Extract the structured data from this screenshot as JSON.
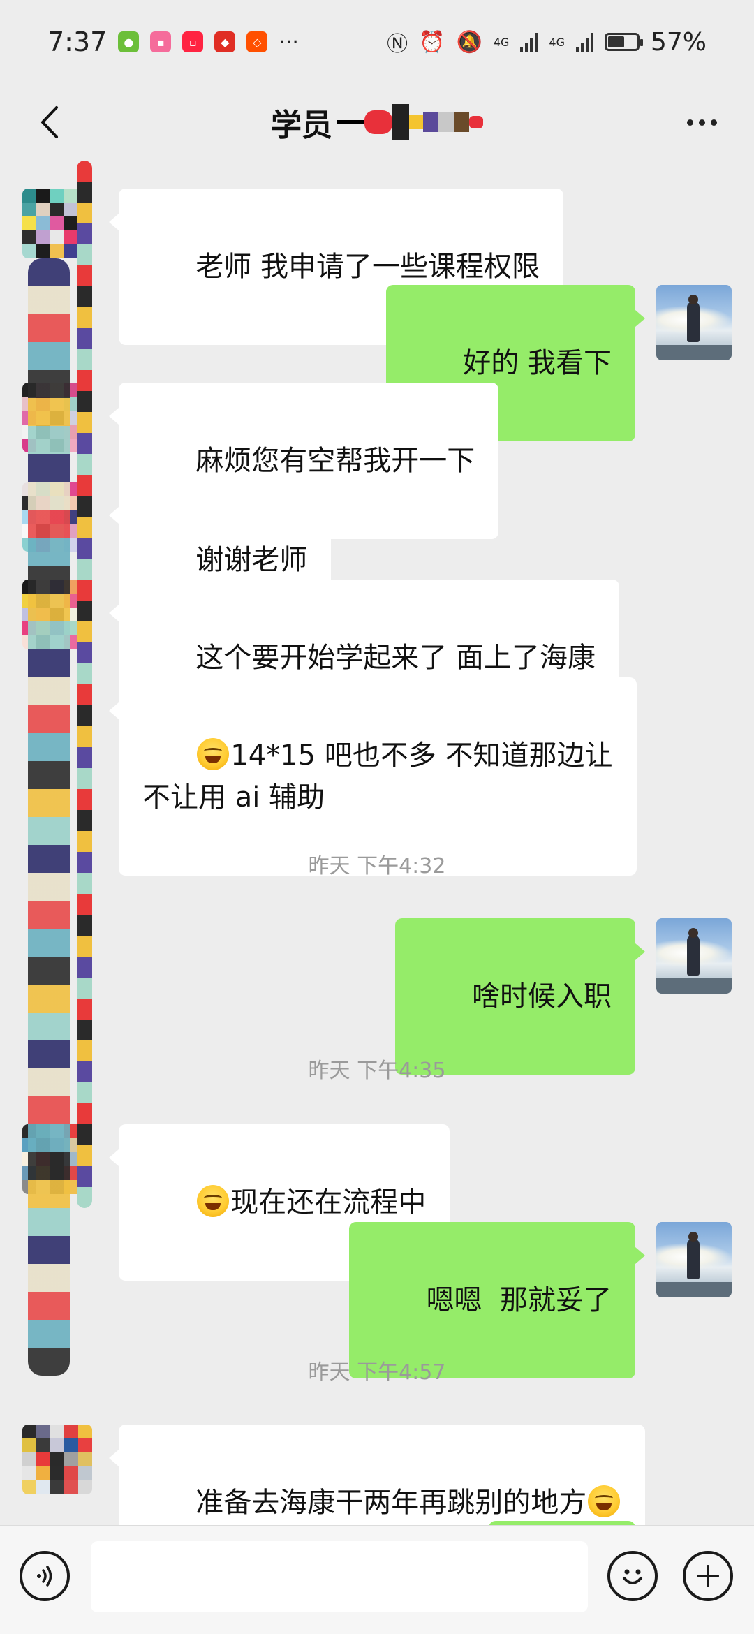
{
  "status_bar": {
    "time": "7:37",
    "more_indicator": "···",
    "network_1": "4G",
    "network_2": "4G",
    "battery": "57%",
    "battery_level": 0.57
  },
  "header": {
    "title": "学员",
    "back_icon": "chevron-left-icon",
    "more_icon": "more-horizontal-icon"
  },
  "messages": [
    {
      "side": "in",
      "text": "老师 我申请了一些课程权限"
    },
    {
      "side": "out",
      "text": "好的 我看下"
    },
    {
      "side": "in",
      "text": "麻烦您有空帮我开一下"
    },
    {
      "side": "in",
      "text": "谢谢老师"
    },
    {
      "side": "in",
      "text": "这个要开始学起来了 面上了海康"
    },
    {
      "side": "in",
      "text_line1": "14*15 吧也不多 不知道那边让",
      "text_line2": "不让用 ai 辅助"
    },
    {
      "side": "out",
      "text": "啥时候入职"
    },
    {
      "side": "in",
      "text": "现在还在流程中"
    },
    {
      "side": "out",
      "text": "嗯嗯  那就妥了"
    },
    {
      "side": "in",
      "text": "准备去海康干两年再跳别的地方"
    }
  ],
  "timestamps": [
    "昨天 下午4:32",
    "昨天 下午4:35",
    "昨天 下午4:57"
  ],
  "input_bar": {
    "placeholder": "",
    "voice_icon": "voice-icon",
    "emoji_icon": "smiley-icon",
    "plus_icon": "plus-icon"
  },
  "colors": {
    "background": "#ededed",
    "outgoing_bubble": "#95ec69",
    "incoming_bubble": "#ffffff",
    "timestamp": "#9a9a9a"
  }
}
